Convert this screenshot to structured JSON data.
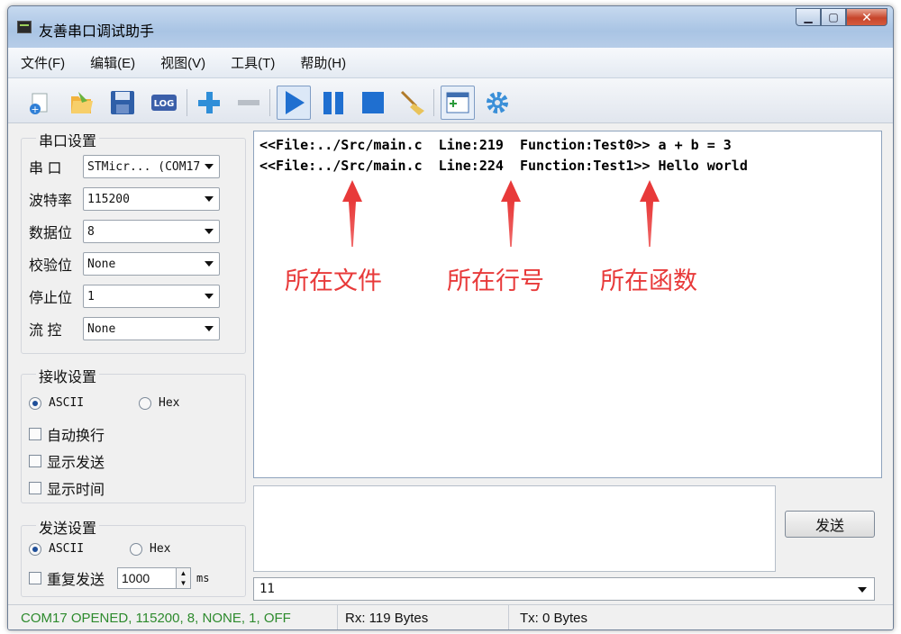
{
  "window": {
    "title": "友善串口调试助手"
  },
  "menu": [
    "文件(F)",
    "编辑(E)",
    "视图(V)",
    "工具(T)",
    "帮助(H)"
  ],
  "toolbar": {
    "icons": [
      "new-file-icon",
      "open-folder-icon",
      "save-icon",
      "log-icon",
      "plus-icon",
      "minus-icon",
      "play-icon",
      "pause-icon",
      "stop-icon",
      "broom-icon",
      "window-add-icon",
      "gear-icon"
    ],
    "log_label": "LOG"
  },
  "serial_settings": {
    "title": "串口设置",
    "port": {
      "label": "串 口",
      "value": "STMicr... (COM17"
    },
    "baud": {
      "label": "波特率",
      "value": "115200"
    },
    "databits": {
      "label": "数据位",
      "value": "8"
    },
    "parity": {
      "label": "校验位",
      "value": "None"
    },
    "stopbits": {
      "label": "停止位",
      "value": "1"
    },
    "flow": {
      "label": "流 控",
      "value": "None"
    }
  },
  "receive_settings": {
    "title": "接收设置",
    "ascii": "ASCII",
    "hex": "Hex",
    "auto_newline": "自动换行",
    "show_send": "显示发送",
    "show_time": "显示时间"
  },
  "send_settings": {
    "title": "发送设置",
    "ascii": "ASCII",
    "hex": "Hex",
    "repeat": "重复发送",
    "interval": "1000",
    "unit": "ms"
  },
  "output": {
    "lines": [
      "<<File:../Src/main.c  Line:219  Function:Test0>> a + b = 3",
      "<<File:../Src/main.c  Line:224  Function:Test1>> Hello world"
    ],
    "annotations": [
      "所在文件",
      "所在行号",
      "所在函数"
    ],
    "annotation_color": "#e83a3a"
  },
  "send": {
    "button": "发送",
    "history_value": "11"
  },
  "status": {
    "connection": "COM17 OPENED, 115200, 8, NONE, 1, OFF",
    "rx": "Rx: 119 Bytes",
    "tx": "Tx: 0 Bytes",
    "connection_color": "#2d8a2d"
  }
}
